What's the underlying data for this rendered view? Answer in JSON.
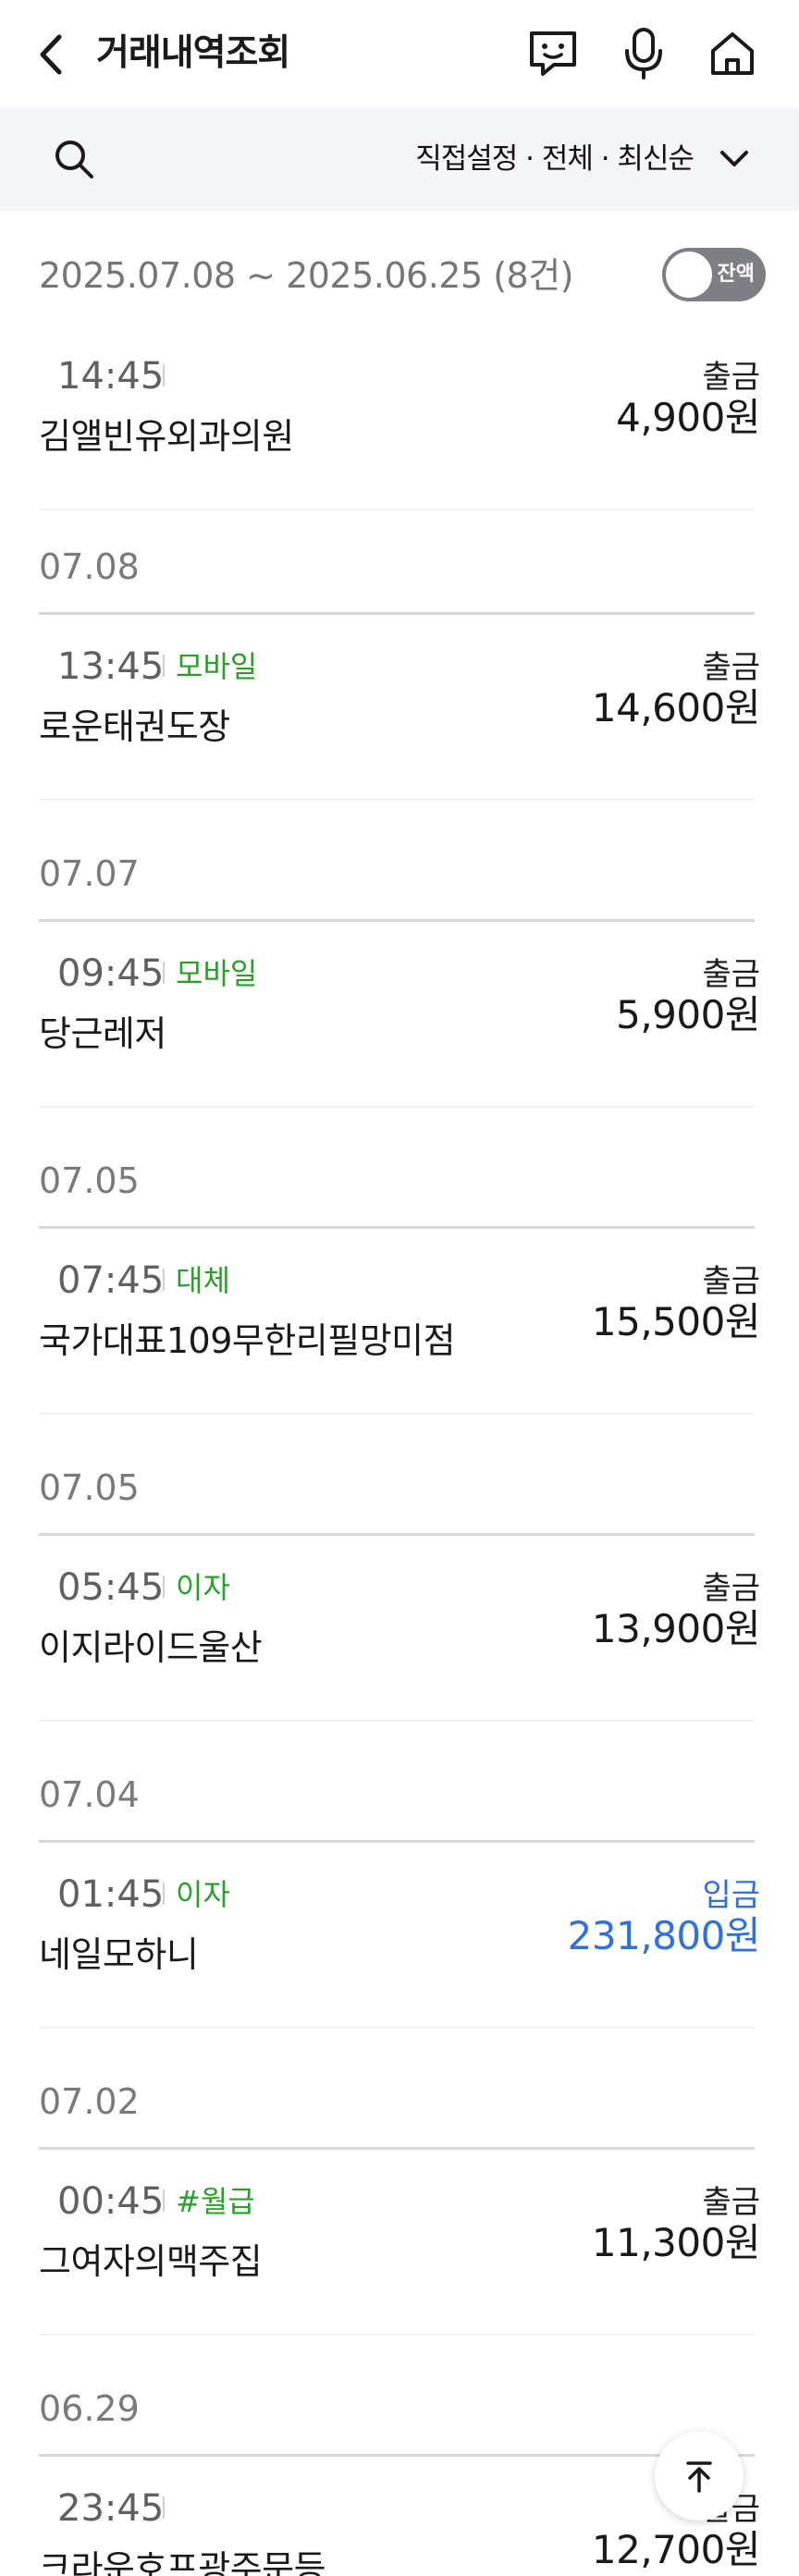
{
  "header": {
    "title": "거래내역조회",
    "icons": [
      "back-icon",
      "chat-bot-icon",
      "microphone-icon",
      "home-icon"
    ]
  },
  "filter": {
    "label": "직접설정 · 전체 · 최신순"
  },
  "range": {
    "text": "2025.07.08 ~ 2025.06.25 (8건)",
    "balance_toggle_label": "잔액"
  },
  "colors": {
    "tag_green": "#27a127",
    "deposit_blue": "#2f6fe8",
    "filter_bg": "#f3f5f9",
    "toggle_gray": "#7d7f84"
  },
  "groups": [
    {
      "date": null,
      "transactions": [
        {
          "time": "14:45",
          "tag": "",
          "name": "김앨빈유외과의원",
          "type": "출금",
          "amount": "4,900원"
        }
      ]
    },
    {
      "date": "07.08",
      "transactions": [
        {
          "time": "13:45",
          "tag": "모바일",
          "name": "로운태권도장",
          "type": "출금",
          "amount": "14,600원"
        }
      ]
    },
    {
      "date": "07.07",
      "transactions": [
        {
          "time": "09:45",
          "tag": "모바일",
          "name": "당근레저",
          "type": "출금",
          "amount": "5,900원"
        }
      ]
    },
    {
      "date": "07.05",
      "transactions": [
        {
          "time": "07:45",
          "tag": "대체",
          "name": "국가대표109무한리필망미점",
          "type": "출금",
          "amount": "15,500원"
        }
      ]
    },
    {
      "date": "07.05",
      "transactions": [
        {
          "time": "05:45",
          "tag": "이자",
          "name": "이지라이드울산",
          "type": "출금",
          "amount": "13,900원"
        }
      ]
    },
    {
      "date": "07.04",
      "transactions": [
        {
          "time": "01:45",
          "tag": "이자",
          "name": "네일모하니",
          "type": "입금",
          "amount": "231,800원"
        }
      ]
    },
    {
      "date": "07.02",
      "transactions": [
        {
          "time": "00:45",
          "tag": "#월급",
          "name": "그여자의맥주집",
          "type": "출금",
          "amount": "11,300원"
        }
      ]
    },
    {
      "date": "06.29",
      "transactions": [
        {
          "time": "23:45",
          "tag": "",
          "name": "크라운호프광주문등",
          "type": "출금",
          "amount": "12,700원"
        }
      ]
    }
  ]
}
